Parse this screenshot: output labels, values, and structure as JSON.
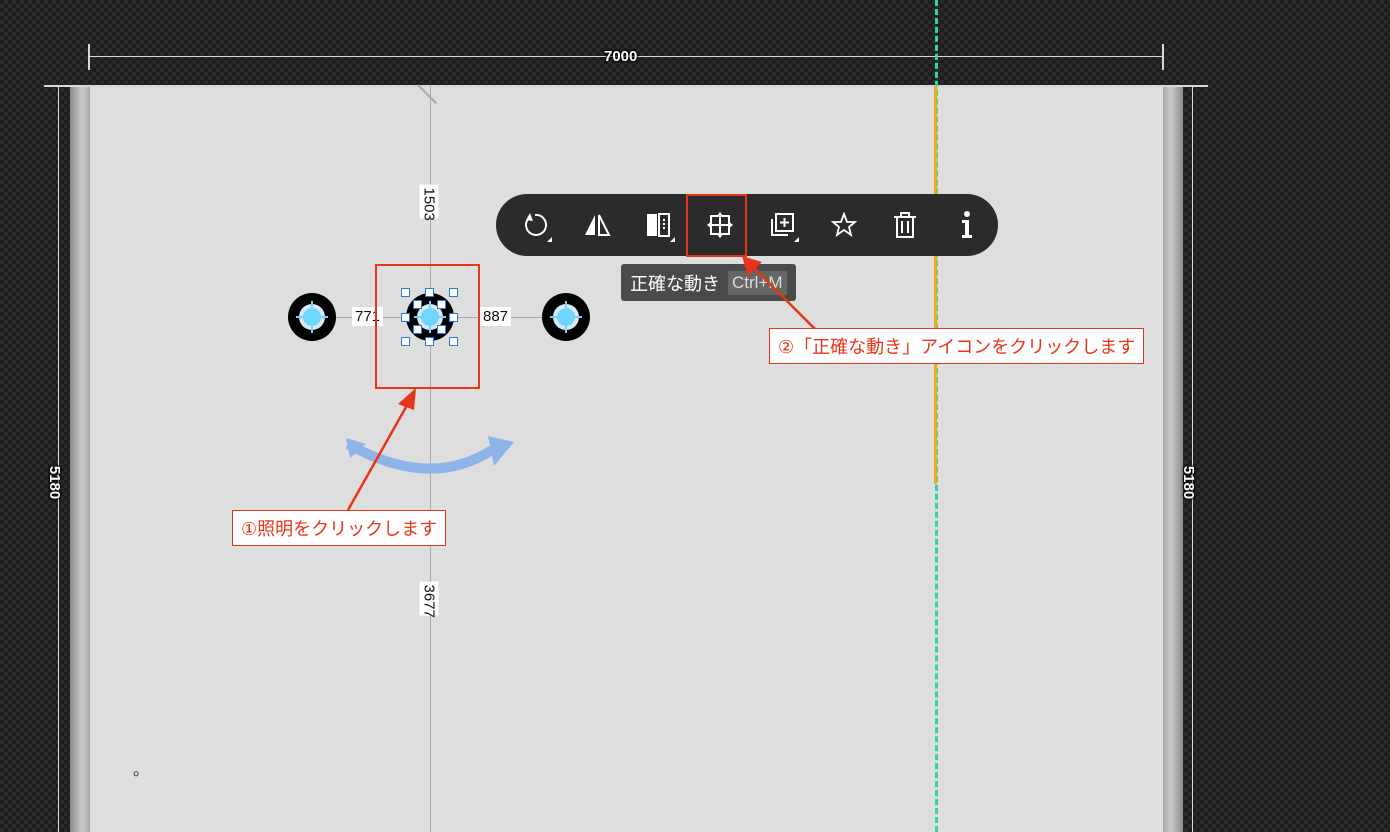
{
  "dimensions": {
    "top_width": "7000",
    "left_height": "5180",
    "right_height": "5180",
    "dist_up": "1503",
    "dist_down": "3677",
    "dist_left": "771",
    "dist_right": "887"
  },
  "toolbar": {
    "buttons": [
      {
        "name": "rotate",
        "icon": "rotate-icon"
      },
      {
        "name": "mirror",
        "icon": "mirror-icon"
      },
      {
        "name": "align",
        "icon": "align-icon"
      },
      {
        "name": "precise-move",
        "icon": "precise-move-icon"
      },
      {
        "name": "duplicate",
        "icon": "duplicate-icon"
      },
      {
        "name": "favorite",
        "icon": "star-icon"
      },
      {
        "name": "delete",
        "icon": "trash-icon"
      },
      {
        "name": "info",
        "icon": "info-icon"
      }
    ]
  },
  "tooltip": {
    "label": "正確な動き",
    "shortcut": "Ctrl+M"
  },
  "callouts": {
    "step1": "①照明をクリックします",
    "step2": "②「正確な動き」アイコンをクリックします"
  },
  "misc": {
    "dot": "。"
  },
  "colors": {
    "accent_red": "#e8351a",
    "guide_teal": "#2fd6a8",
    "guide_orange": "#f3a81a",
    "light_blue": "#6fd6ff",
    "selection_blue": "#2a7be0",
    "toolbar_bg": "#2b2b2b"
  }
}
